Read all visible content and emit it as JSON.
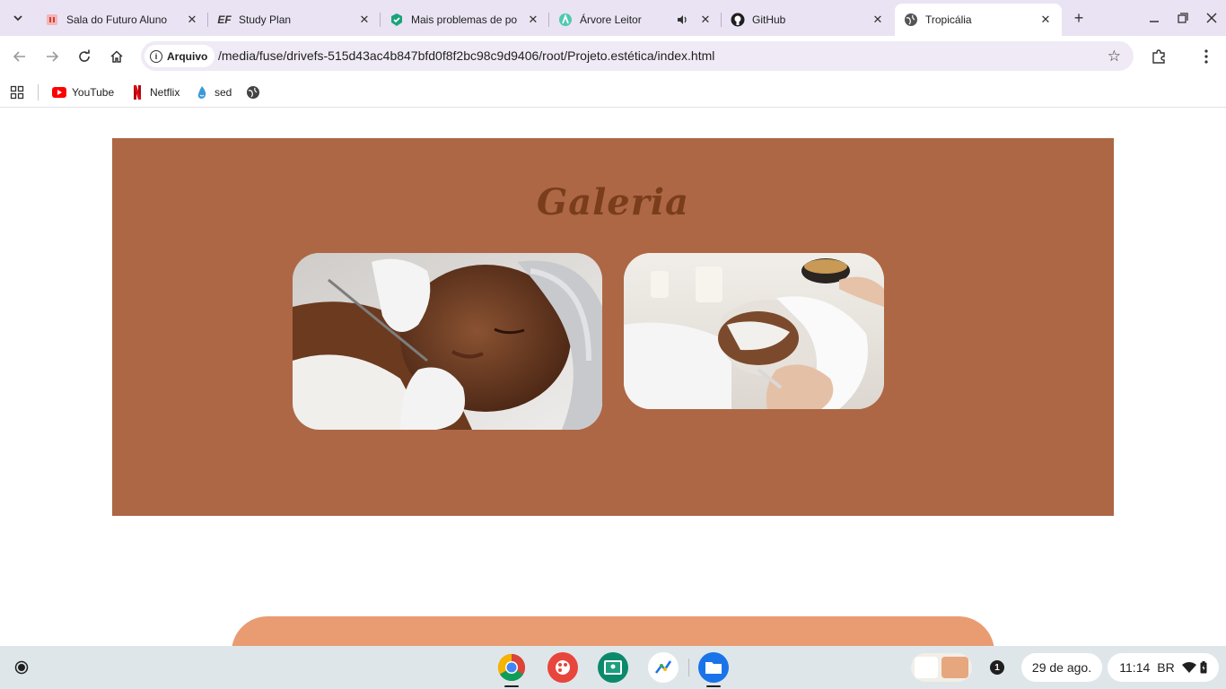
{
  "browser": {
    "tabs": [
      {
        "title": "Sala do Futuro Aluno",
        "icon": "sala-futuro-favicon"
      },
      {
        "title": "Study Plan",
        "icon": "ef-favicon",
        "icon_text": "EF"
      },
      {
        "title": "Mais problemas de po",
        "icon": "shield-check-favicon"
      },
      {
        "title": "Árvore Leitor",
        "icon": "arvore-favicon",
        "audio": true
      },
      {
        "title": "GitHub",
        "icon": "github-icon"
      },
      {
        "title": "Tropicália",
        "icon": "globe-icon",
        "active": true
      }
    ],
    "omnibox": {
      "chip_label": "Arquivo",
      "url": "/media/fuse/drivefs-515d43ac4b847bfd0f8f2bc98c9d9406/root/Projeto.estética/index.html"
    },
    "bookmarks": [
      {
        "label": "YouTube",
        "icon": "youtube-icon"
      },
      {
        "label": "Netflix",
        "icon": "netflix-icon"
      },
      {
        "label": "sed",
        "icon": "sed-icon"
      },
      {
        "label": "",
        "icon": "globe-icon"
      }
    ]
  },
  "page": {
    "gallery_title": "Galeria",
    "colors": {
      "section_bg": "#ad6745",
      "title": "#7a3d1c",
      "footer_bar": "#e99c72"
    },
    "photos": [
      {
        "name": "gallery-photo-facial-treatment-1"
      },
      {
        "name": "gallery-photo-facial-mask-2"
      }
    ]
  },
  "shelf": {
    "apps": [
      "chrome-icon",
      "canvas-icon",
      "classroom-icon",
      "cursive-icon",
      "files-icon"
    ],
    "notification_count": "1",
    "date": "29 de ago.",
    "time": "11:14",
    "locale": "BR"
  }
}
